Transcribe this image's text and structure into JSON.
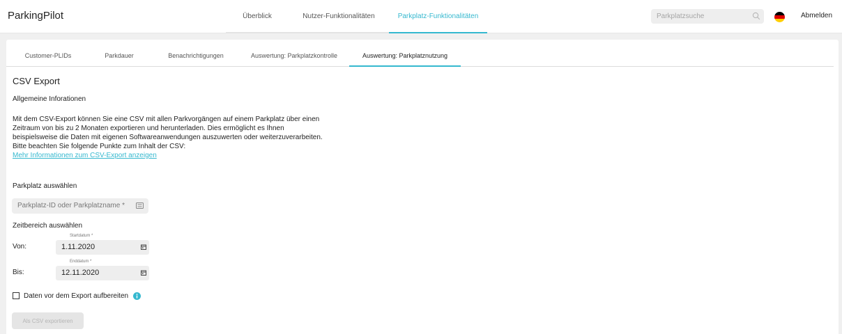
{
  "app": {
    "title": "ParkingPilot",
    "accent": "#35b8cf"
  },
  "mainnav": {
    "items": [
      "Überblick",
      "Nutzer-Funktionalitäten",
      "Parkplatz-Funktionalitäten"
    ],
    "active_index": 2
  },
  "search": {
    "placeholder": "Parkplatzsuche",
    "icon": "search-icon"
  },
  "language": {
    "flag": "german-flag-icon",
    "colors": [
      "#000000",
      "#dd0000",
      "#ffce00"
    ]
  },
  "logout_label": "Abmelden",
  "tabs": {
    "items": [
      "Customer-PLIDs",
      "Parkdauer",
      "Benachrichtigungen",
      "Auswertung: Parkplatzkontrolle",
      "Auswertung: Parkplatznutzung"
    ],
    "active_index": 4
  },
  "section": {
    "title": "CSV Export",
    "subtitle": "Allgemeine Inforationen",
    "paragraph": [
      "Mit dem CSV-Export können Sie eine CSV mit allen Parkvorgängen auf einem Parkplatz über einen",
      "Zeitraum von bis zu 2 Monaten exportieren und herunterladen. Dies ermöglicht es Ihnen",
      "beispielsweise die Daten mit eigenen Softwareanwendungen auszuwerten oder weiterzuverarbeiten.",
      "Bitte beachten Sie folgende Punkte zum Inhalt der CSV:"
    ],
    "more_link": "Mehr Informationen zum CSV-Export anzeigen"
  },
  "lot": {
    "label": "Parkplatz auswählen",
    "placeholder": "Parkplatz-ID oder Parkplatzname *"
  },
  "timerange": {
    "label": "Zeitbereich auswählen",
    "from_label": "Von:",
    "start_caption": "Startdatum *",
    "start_value": "1.11.2020",
    "to_label": "Bis:",
    "end_caption": "Enddatum *",
    "end_value": "12.11.2020"
  },
  "prepare": {
    "label": "Daten vor dem Export aufbereiten",
    "checked": false
  },
  "export_button": "Als CSV exportieren"
}
